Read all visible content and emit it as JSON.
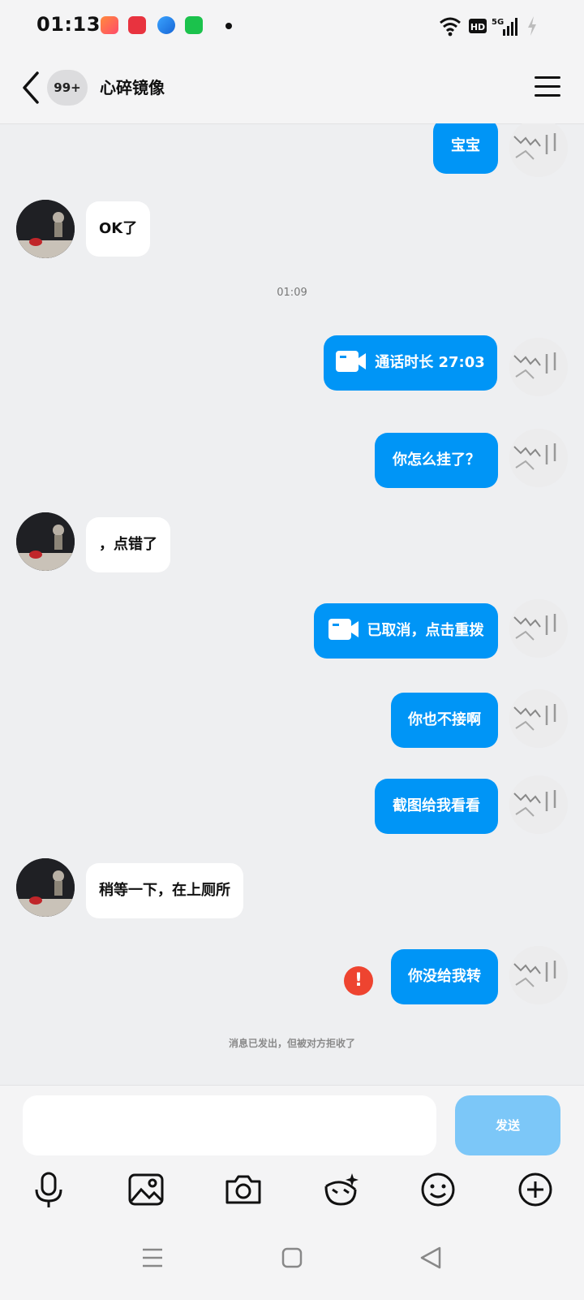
{
  "status_bar": {
    "time": "01:13",
    "network": "5G",
    "hd_label": "HD"
  },
  "header": {
    "unread_count": "99+",
    "contact_name": "心碎镜像"
  },
  "messages": [
    {
      "direction": "out",
      "text": "宝宝"
    },
    {
      "direction": "in",
      "text": "OK了"
    },
    {
      "type": "timestamp",
      "text": "01:09"
    },
    {
      "direction": "out",
      "type": "video-call",
      "text": "通话时长 27:03"
    },
    {
      "direction": "out",
      "text": "你怎么挂了？"
    },
    {
      "direction": "in",
      "text": "，点错了"
    },
    {
      "direction": "out",
      "type": "video-call",
      "text": "已取消，点击重拨"
    },
    {
      "direction": "out",
      "text": "你也不接啊"
    },
    {
      "direction": "out",
      "text": "截图给我看看"
    },
    {
      "direction": "in",
      "text": "稍等一下，在上厕所"
    },
    {
      "direction": "out",
      "text": "你没给我转",
      "failed": true,
      "error_mark": "!"
    }
  ],
  "notice": "消息已发出，但被对方拒收了",
  "composer": {
    "input_value": "",
    "send_label": "发送"
  },
  "toolbar_icons": [
    "microphone-icon",
    "image-icon",
    "camera-icon",
    "sticker-icon",
    "emoji-icon",
    "plus-icon"
  ],
  "nav_icons": [
    "recents-icon",
    "home-icon",
    "back-icon"
  ],
  "colors": {
    "accent": "#0095f6",
    "send_disabled": "#7cc7f8",
    "error": "#ee4430",
    "background": "#eeeff1"
  }
}
